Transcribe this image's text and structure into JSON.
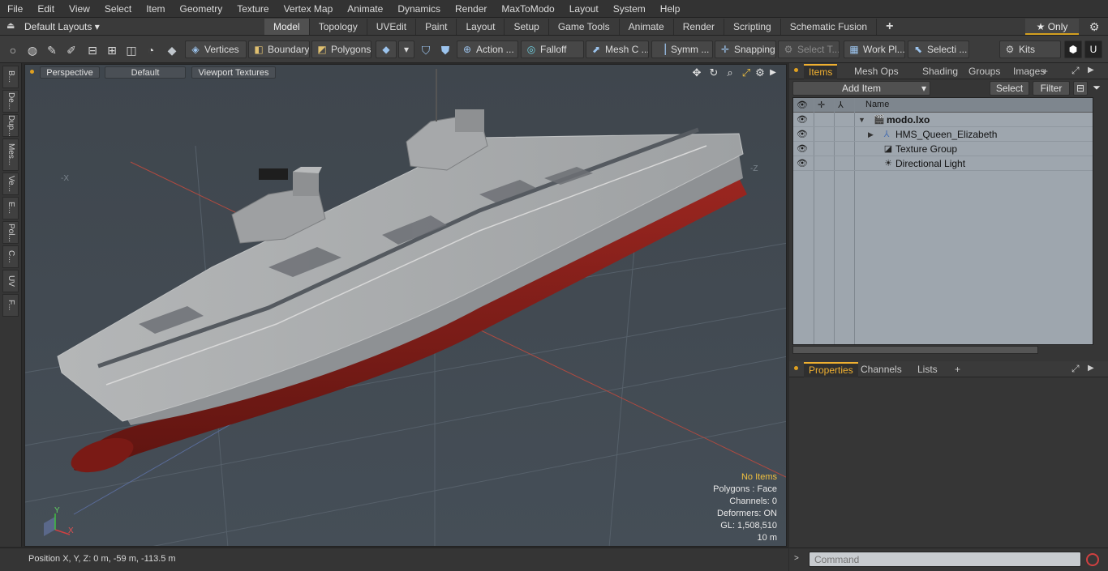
{
  "menu": [
    "File",
    "Edit",
    "View",
    "Select",
    "Item",
    "Geometry",
    "Texture",
    "Vertex Map",
    "Animate",
    "Dynamics",
    "Render",
    "MaxToModo",
    "Layout",
    "System",
    "Help"
  ],
  "layout": {
    "selector": "Default Layouts ▾",
    "tabs": [
      "Model",
      "Topology",
      "UVEdit",
      "Paint",
      "Layout",
      "Setup",
      "Game Tools",
      "Animate",
      "Render",
      "Scripting",
      "Schematic Fusion"
    ],
    "active_tab": "Model",
    "add_tab": "+",
    "only_label": "★  Only"
  },
  "toolbar": {
    "vertices": "Vertices",
    "boundary": "Boundary",
    "polygons": "Polygons",
    "action": "Action  ...",
    "falloff": "Falloff",
    "mesh_c": "Mesh C ...",
    "symm": "Symm ...",
    "snapping": "Snapping",
    "select_t": "Select T...",
    "work_pl": "Work Pl...",
    "selecti": "Selecti ...",
    "kits": "Kits"
  },
  "left_strip": [
    "B...",
    "De...",
    "Dup...",
    "Mes...",
    "Ve...",
    "E...",
    "Pol...",
    "C...",
    "UV",
    "F..."
  ],
  "viewport": {
    "perspective": "Perspective",
    "default": "Default",
    "textures": "Viewport Textures",
    "axis_x": "X",
    "axis_y": "Y",
    "neg_x": "-X",
    "neg_z": "-Z",
    "stats": {
      "items": "No Items",
      "polygons": "Polygons : Face",
      "channels": "Channels: 0",
      "deformers": "Deformers: ON",
      "gl": "GL: 1,508,510",
      "scale": "10 m"
    }
  },
  "status": {
    "position": "Position X, Y, Z:   0 m, -59 m, -113.5 m"
  },
  "items_panel": {
    "tabs": [
      "Items",
      "Mesh Ops",
      "Shading",
      "Groups",
      "Images"
    ],
    "add_tab": "+",
    "add_item": "Add Item",
    "select": "Select",
    "filter": "Filter",
    "column_name": "Name",
    "rows": [
      {
        "label": "modo.lxo",
        "bold": true
      },
      {
        "label": "HMS_Queen_Elizabeth",
        "bold": false
      },
      {
        "label": "Texture Group",
        "bold": false
      },
      {
        "label": "Directional Light",
        "bold": false
      }
    ]
  },
  "props_panel": {
    "tabs": [
      "Properties",
      "Channels",
      "Lists"
    ],
    "add_tab": "+"
  },
  "command": {
    "placeholder": "Command"
  },
  "colors": {
    "accent": "#f0b030",
    "viewport_bg": "#414a52",
    "hull_red": "#8a1e1a",
    "deck_gray": "#a9abac"
  }
}
